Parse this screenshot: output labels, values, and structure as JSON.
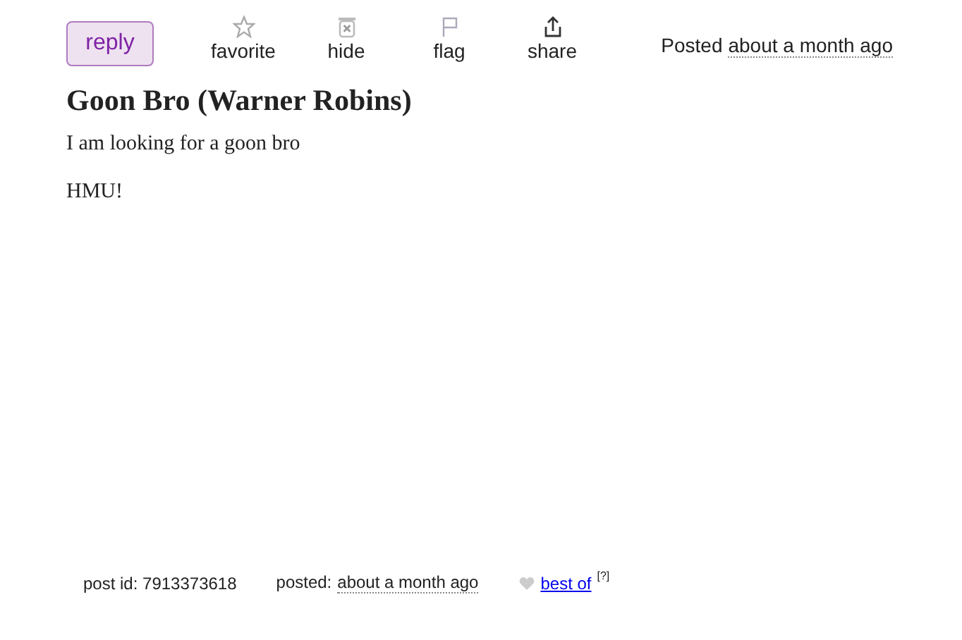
{
  "reply_button": "reply",
  "actions": [
    {
      "kind": "star",
      "label": "favorite"
    },
    {
      "kind": "hide",
      "label": "hide"
    },
    {
      "kind": "flag",
      "label": "flag"
    },
    {
      "kind": "share",
      "label": "share"
    }
  ],
  "posted": {
    "label": "Posted",
    "time": "about a month ago"
  },
  "title": "Goon Bro (Warner Robins)",
  "body": [
    "I am looking for a goon bro",
    "HMU!"
  ],
  "footer": {
    "post_id": "post id: 7913373618",
    "posted_label": "posted:",
    "posted_time": "about a month ago",
    "best_of": "best of",
    "help": "[?]"
  }
}
